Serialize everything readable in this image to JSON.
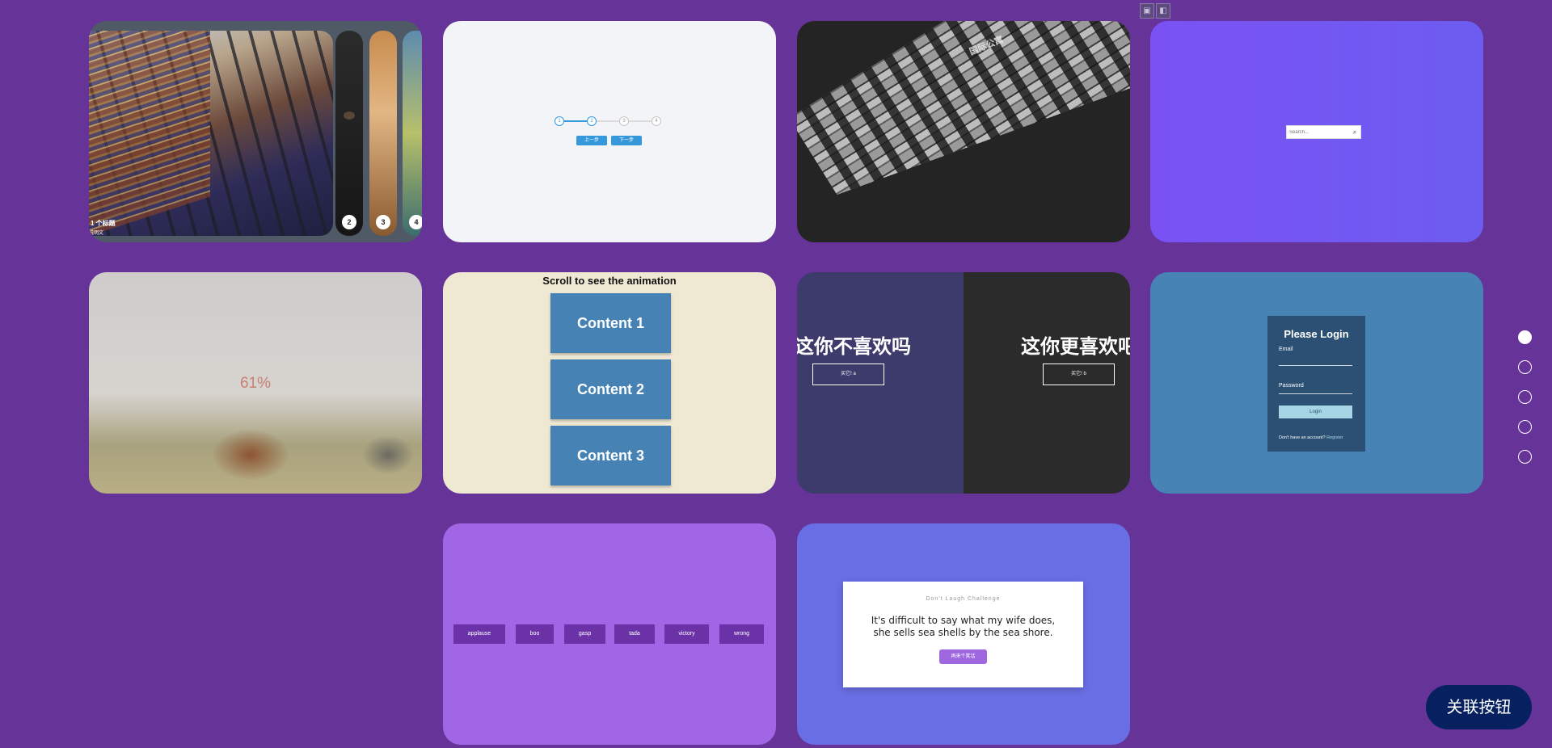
{
  "slider": {
    "caption": "1 个标题",
    "sub": "说明文",
    "nums": [
      "2",
      "3",
      "4"
    ]
  },
  "stepper": {
    "steps": [
      "1",
      "2",
      "3",
      "4"
    ],
    "prev": "上一步",
    "next": "下一步"
  },
  "building": {
    "sign": "国际公寓"
  },
  "search": {
    "placeholder": "Search..."
  },
  "loading": {
    "percent": "61%"
  },
  "scroll": {
    "title": "Scroll to see the animation",
    "items": [
      "Content 1",
      "Content 2",
      "Content 3"
    ]
  },
  "split": {
    "left_title": "这你不喜欢吗",
    "right_title": "这你更喜欢吧",
    "left_btn": "买它! a",
    "right_btn": "买它! b"
  },
  "login": {
    "title": "Please Login",
    "email_label": "Email",
    "password_label": "Password",
    "button": "Login",
    "footer_text": "Don't have an account?",
    "footer_link": "Register"
  },
  "sounds": [
    "applause",
    "boo",
    "gasp",
    "tada",
    "victory",
    "wrong"
  ],
  "joke": {
    "heading": "Don't Laugh Challenge",
    "line1": "It's difficult to say what my wife does,",
    "line2": "she sells sea shells by the sea shore.",
    "button": "再来个笑话"
  },
  "float_button": "关联按钮",
  "pagination": {
    "count": 5,
    "active": 0
  }
}
